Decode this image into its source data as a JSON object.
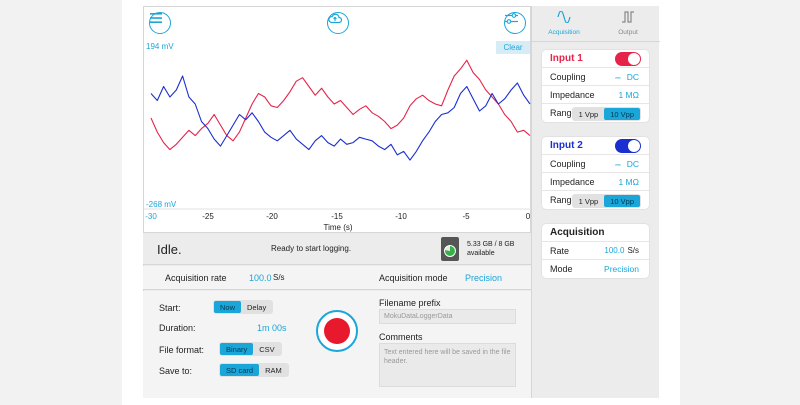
{
  "plot": {
    "y_top_label": "194 mV",
    "y_bottom_label": "-268 mV",
    "clear_label": "Clear",
    "x_ticks": [
      "-30",
      "-25",
      "-20",
      "-15",
      "-10",
      "-5",
      "0"
    ],
    "x_axis_title": "Time (s)",
    "series_colors": {
      "input1": "#e8234a",
      "input2": "#1a2fcf"
    },
    "accent": "#1aa6d9",
    "icons": {
      "menu": "menu-icon",
      "cloud": "cloud-upload-icon",
      "settings": "sliders-icon"
    }
  },
  "chart_data": {
    "type": "line",
    "xlabel": "Time (s)",
    "x_ticks": [
      -30,
      -25,
      -20,
      -15,
      -10,
      -5,
      0
    ],
    "xlim": [
      -30,
      0
    ],
    "ylim": [
      -268,
      194
    ],
    "y_unit": "mV",
    "series": [
      {
        "color": "#e8234a",
        "x": [
          -30,
          -29.5,
          -29,
          -28.5,
          -28,
          -27.5,
          -27,
          -26.5,
          -26,
          -25.5,
          -25,
          -24.5,
          -24,
          -23.5,
          -23,
          -22.5,
          -22,
          -21.5,
          -21,
          -20.5,
          -20,
          -19.5,
          -19,
          -18.5,
          -18,
          -17.5,
          -17,
          -16.5,
          -16,
          -15.5,
          -15,
          -14.5,
          -14,
          -13.5,
          -13,
          -12.5,
          -12,
          -11.5,
          -11,
          -10.5,
          -10,
          -9.5,
          -9,
          -8.5,
          -8,
          -7.5,
          -7,
          -6.5,
          -6,
          -5.5,
          -5,
          -4.5,
          -4,
          -3.5,
          -3,
          -2.5,
          -2,
          -1.5,
          -1,
          -0.5,
          0
        ],
        "y": [
          -20,
          -60,
          -90,
          -110,
          -95,
          -75,
          -55,
          -70,
          -50,
          -35,
          -10,
          -40,
          -70,
          -85,
          -60,
          -20,
          20,
          50,
          40,
          15,
          10,
          30,
          55,
          85,
          95,
          70,
          45,
          65,
          40,
          20,
          30,
          10,
          -10,
          5,
          15,
          -5,
          -15,
          -30,
          -50,
          -40,
          -20,
          15,
          35,
          45,
          30,
          20,
          15,
          60,
          100,
          120,
          145,
          110,
          90,
          60,
          40,
          20,
          -10,
          -30,
          -60,
          -55,
          -70
        ]
      },
      {
        "color": "#1a2fcf",
        "x": [
          -30,
          -29.5,
          -29,
          -28.5,
          -28,
          -27.5,
          -27,
          -26.5,
          -26,
          -25.5,
          -25,
          -24.5,
          -24,
          -23.5,
          -23,
          -22.5,
          -22,
          -21.5,
          -21,
          -20.5,
          -20,
          -19.5,
          -19,
          -18.5,
          -18,
          -17.5,
          -17,
          -16.5,
          -16,
          -15.5,
          -15,
          -14.5,
          -14,
          -13.5,
          -13,
          -12.5,
          -12,
          -11.5,
          -11,
          -10.5,
          -10,
          -9.5,
          -9,
          -8.5,
          -8,
          -7.5,
          -7,
          -6.5,
          -6,
          -5.5,
          -5,
          -4.5,
          -4,
          -3.5,
          -3,
          -2.5,
          -2,
          -1.5,
          -1,
          -0.5,
          0
        ],
        "y": [
          50,
          30,
          70,
          40,
          60,
          100,
          40,
          20,
          -30,
          -50,
          -80,
          -100,
          -70,
          -40,
          -10,
          -25,
          -5,
          -30,
          -60,
          -75,
          -85,
          -70,
          -55,
          -80,
          -95,
          -110,
          -85,
          -70,
          -90,
          -100,
          -80,
          -95,
          -90,
          -75,
          -80,
          -85,
          -100,
          -110,
          -95,
          -125,
          -115,
          -140,
          -115,
          -85,
          -60,
          -30,
          -10,
          -5,
          10,
          50,
          70,
          35,
          0,
          15,
          50,
          20,
          35,
          60,
          80,
          45,
          20
        ]
      }
    ]
  },
  "status": {
    "title": "Idle.",
    "message": "Ready to start logging.",
    "storage_line1": "5.33 GB / 8 GB",
    "storage_line2": "available",
    "storage_free_fraction": 0.78
  },
  "rate_row": {
    "rate_label": "Acquisition rate",
    "rate_value": "100.0",
    "rate_unit": "S/s",
    "mode_label": "Acquisition mode",
    "mode_value": "Precision"
  },
  "settings": {
    "start_label": "Start:",
    "start_options": [
      "Now",
      "Delay"
    ],
    "duration_label": "Duration:",
    "duration_value": "1m 00s",
    "format_label": "File format:",
    "format_options": [
      "Binary",
      "CSV"
    ],
    "save_label": "Save to:",
    "save_options": [
      "SD card",
      "RAM"
    ],
    "filename_label": "Filename prefix",
    "filename_placeholder": "MokuDataLoggerData",
    "comments_label": "Comments",
    "comments_placeholder": "Text entered here will be saved in the file header."
  },
  "right_panel": {
    "tabs": [
      "Acquisition",
      "Output"
    ],
    "input1": {
      "title": "Input 1",
      "title_color": "#e8234a",
      "enabled": true,
      "coupling_label": "Coupling",
      "coupling_value": "DC",
      "impedance_label": "Impedance",
      "impedance_value": "1 MΩ",
      "range_label": "Range",
      "range_options": [
        "1 Vpp",
        "10 Vpp"
      ]
    },
    "input2": {
      "title": "Input 2",
      "title_color": "#1a2fcf",
      "enabled": true,
      "coupling_label": "Coupling",
      "coupling_value": "DC",
      "impedance_label": "Impedance",
      "impedance_value": "1 MΩ",
      "range_label": "Range",
      "range_options": [
        "1 Vpp",
        "10 Vpp"
      ]
    },
    "acquisition": {
      "title": "Acquisition",
      "rate_label": "Rate",
      "rate_value": "100.0",
      "rate_unit": "S/s",
      "mode_label": "Mode",
      "mode_value": "Precision"
    }
  }
}
